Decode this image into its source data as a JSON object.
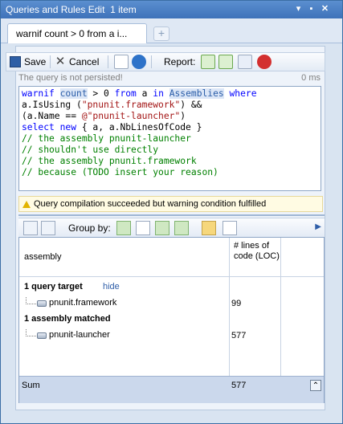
{
  "window": {
    "title": "Queries and Rules Edit",
    "item_count": "1 item"
  },
  "tab": {
    "label": "warnif count > 0 from a i..."
  },
  "toolbar": {
    "save": "Save",
    "cancel": "Cancel",
    "report": "Report:"
  },
  "status": {
    "message": "The query is not persisted!",
    "time": "0 ms"
  },
  "query": {
    "line1": [
      "warnif ",
      "count",
      " > ",
      "0",
      " from ",
      "a",
      " in ",
      "Assemblies",
      " where"
    ],
    "line2": "a.IsUsing (",
    "line2_str": "\"pnunit.framework\"",
    "line2_end": ") &&",
    "line3": "(a.Name == ",
    "line3_str": "@\"pnunit-launcher\"",
    "line3_end": ")",
    "line4_kw1": "select",
    "line4_kw2": "new",
    "line4_rest": " { a, a.NbLinesOfCode }",
    "comments": [
      "// the assembly pnunit-launcher",
      "// shouldn't use directly",
      "// the assembly pnunit.framework",
      "// because (TODO insert your reason)"
    ]
  },
  "warning": {
    "text": "Query compilation succeeded but warning condition fulfilled"
  },
  "groupby": {
    "label": "Group by:"
  },
  "grid": {
    "columns": [
      "assembly",
      "# lines of code (LOC)"
    ],
    "query_target": {
      "label": "1 query target",
      "hide": "hide",
      "name": "pnunit.framework",
      "loc": "99"
    },
    "matched": {
      "label": "1 assembly matched",
      "name": "pnunit-launcher",
      "loc": "577"
    },
    "sum": {
      "label": "Sum",
      "value": "577"
    }
  },
  "colors": {
    "title_bar": "#3e72b9",
    "keyword": "#0000ff",
    "string": "#a31515",
    "comment": "#008000"
  }
}
